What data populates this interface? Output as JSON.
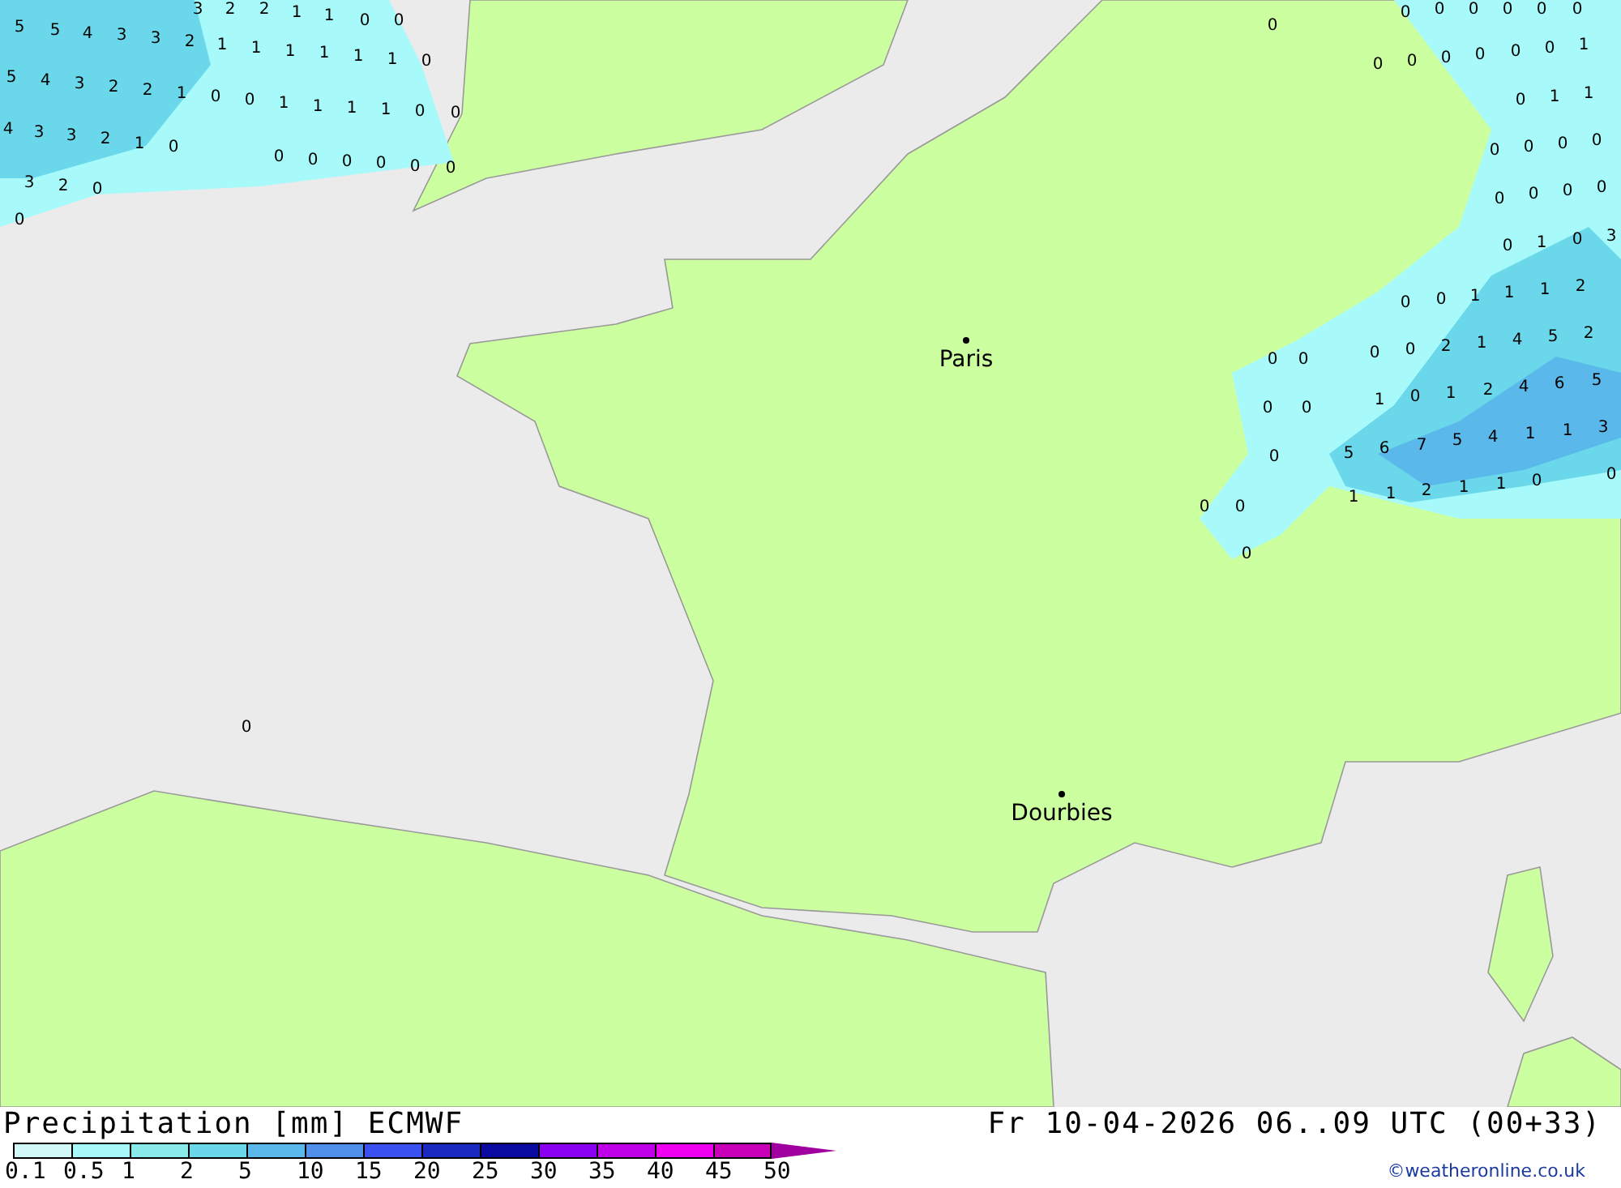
{
  "map": {
    "cities": [
      {
        "name": "Paris"
      },
      {
        "name": "Dourbies"
      }
    ],
    "precipitation_values": [
      "3",
      "2",
      "2",
      "1",
      "1",
      "0",
      "0",
      "5",
      "5",
      "4",
      "3",
      "3",
      "2",
      "1",
      "1",
      "1",
      "1",
      "1",
      "1",
      "0",
      "5",
      "4",
      "3",
      "2",
      "2",
      "1",
      "0",
      "0",
      "1",
      "1",
      "1",
      "1",
      "0",
      "0",
      "4",
      "3",
      "3",
      "2",
      "1",
      "0",
      "0",
      "0",
      "0",
      "0",
      "0",
      "0",
      "3",
      "2",
      "0",
      "0",
      "0",
      "0",
      "0",
      "0",
      "0",
      "0",
      "0",
      "0",
      "0",
      "0",
      "0",
      "0",
      "0",
      "0",
      "1",
      "0",
      "1",
      "1",
      "0",
      "0",
      "0",
      "0",
      "0",
      "0",
      "0",
      "0",
      "0",
      "1",
      "0",
      "3",
      "0",
      "0",
      "1",
      "1",
      "1",
      "2",
      "0",
      "0",
      "0",
      "0",
      "2",
      "1",
      "4",
      "5",
      "2",
      "0",
      "0",
      "1",
      "0",
      "1",
      "2",
      "4",
      "6",
      "5",
      "0",
      "5",
      "6",
      "7",
      "5",
      "4",
      "1",
      "1",
      "3",
      "1",
      "1",
      "2",
      "1",
      "1",
      "0",
      "0",
      "0",
      "0",
      "0"
    ]
  },
  "footer": {
    "title": "Precipitation [mm] ECMWF",
    "valid_time": "Fr 10-04-2026 06..09 UTC (00+33)",
    "credit": "©weatheronline.co.uk"
  },
  "legend": {
    "bins": [
      {
        "color": "#d2f8f8"
      },
      {
        "color": "#a8fafa"
      },
      {
        "color": "#8aeaea"
      },
      {
        "color": "#6ad8ea"
      },
      {
        "color": "#5ab8ea"
      },
      {
        "color": "#5090ea"
      },
      {
        "color": "#3a50f0"
      },
      {
        "color": "#1a2ac0"
      },
      {
        "color": "#0a0aa0"
      },
      {
        "color": "#8a00f0"
      },
      {
        "color": "#c000e8"
      },
      {
        "color": "#f000f0"
      },
      {
        "color": "#c800b8"
      },
      {
        "kind": "arrow",
        "color": "#a000a0"
      }
    ],
    "labels": [
      "0.1",
      "0.5",
      "1",
      "2",
      "5",
      "10",
      "15",
      "20",
      "25",
      "30",
      "35",
      "40",
      "45",
      "50"
    ]
  }
}
